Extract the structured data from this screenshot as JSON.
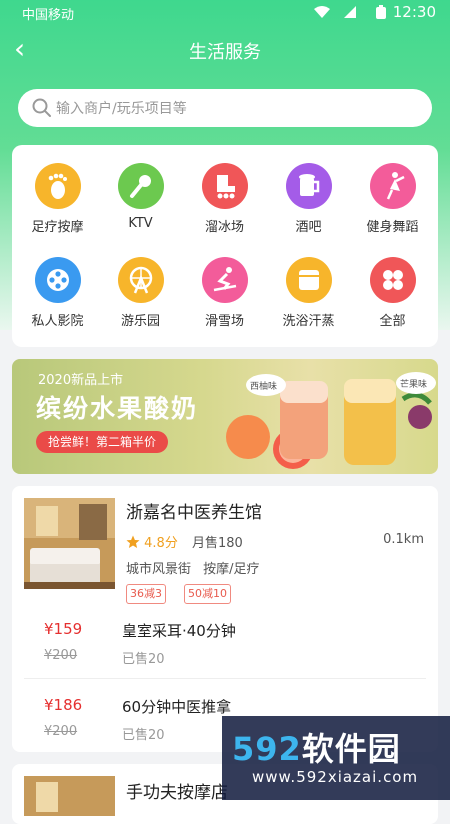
{
  "status": {
    "carrier": "中国移动",
    "time": "12:30"
  },
  "nav": {
    "back_icon": "chevron-left-icon",
    "title": "生活服务"
  },
  "search": {
    "placeholder": "输入商户/玩乐项目等"
  },
  "categories": [
    {
      "label": "足疗按摩",
      "icon": "footprint-icon",
      "color": "#f7b52b"
    },
    {
      "label": "KTV",
      "icon": "microphone-icon",
      "color": "#6cc94f"
    },
    {
      "label": "溜冰场",
      "icon": "roller-skate-icon",
      "color": "#f05658"
    },
    {
      "label": "酒吧",
      "icon": "beer-mug-icon",
      "color": "#a45ce8"
    },
    {
      "label": "健身舞蹈",
      "icon": "dancer-icon",
      "color": "#f35c9a"
    },
    {
      "label": "私人影院",
      "icon": "film-reel-icon",
      "color": "#3a9af0"
    },
    {
      "label": "游乐园",
      "icon": "ferris-wheel-icon",
      "color": "#f7b52b"
    },
    {
      "label": "滑雪场",
      "icon": "skier-icon",
      "color": "#f35c9a"
    },
    {
      "label": "洗浴汗蒸",
      "icon": "bath-towel-icon",
      "color": "#f7b52b"
    },
    {
      "label": "全部",
      "icon": "grid-all-icon",
      "color": "#f05658"
    }
  ],
  "banner": {
    "top_text": "2020新品上市",
    "main_text": "缤纷水果酸奶",
    "tag_text": "抢尝鲜！第二箱半价",
    "bubble_left": "西柚味",
    "bubble_right": "芒果味"
  },
  "shop": {
    "name": "浙嘉名中医养生馆",
    "rating": "4.8分",
    "sales": "月售180",
    "distance": "0.1km",
    "address": "城市风景街",
    "category": "按摩/足疗",
    "badges": [
      "36减3",
      "50减10"
    ],
    "deals": [
      {
        "price": "¥159",
        "orig": "¥200",
        "name": "皇室采耳·40分钟",
        "sold": "已售20"
      },
      {
        "price": "¥186",
        "orig": "¥200",
        "name": "60分钟中医推拿",
        "sold": "已售20"
      }
    ]
  },
  "shop2": {
    "name": "手功夫按摩店"
  },
  "watermark": {
    "num": "592",
    "text": "软件园",
    "url": "www.592xiazai.com"
  },
  "colors": {
    "primary": "#3fd88e",
    "price": "#e53030",
    "rating": "#f0a020"
  }
}
